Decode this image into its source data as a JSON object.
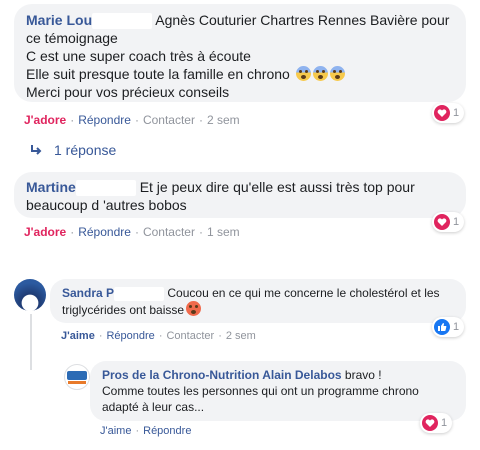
{
  "comments": [
    {
      "author": "Marie Lou",
      "lines": [
        "Agnès Couturier Chartres Rennes Bavière pour",
        "ce témoignage",
        "C est une super coach très à écoute",
        "Elle suit presque toute la famille en chrono",
        "Merci pour vos précieux conseils"
      ],
      "actions": {
        "reaction": "J'adore",
        "reply": "Répondre",
        "contact": "Contacter",
        "time": "2 sem"
      },
      "reaction_count": "1"
    },
    {
      "author": "Martine",
      "lines": [
        "Et je peux dire qu'elle est aussi très top pour",
        "beaucoup d 'autres bobos"
      ],
      "actions": {
        "reaction": "J'adore",
        "reply": "Répondre",
        "contact": "Contacter",
        "time": "1 sem"
      },
      "reaction_count": "1"
    },
    {
      "author": "Sandra P",
      "lines": [
        "Coucou en ce qui me concerne le cholestérol et les",
        "triglycérides ont baisse"
      ],
      "actions": {
        "reaction": "J'aime",
        "reply": "Répondre",
        "contact": "Contacter",
        "time": "2 sem"
      },
      "reaction_count": "1"
    },
    {
      "author": "Pros de la Chrono-Nutrition Alain Delabos",
      "lines": [
        "bravo !",
        "Comme toutes les personnes qui ont un programme chrono",
        "adapté à leur cas..."
      ],
      "actions": {
        "reaction": "J'aime",
        "reply": "Répondre"
      },
      "reaction_count": "1"
    }
  ],
  "replies_link": "1 réponse",
  "icons": {
    "love": "heart-icon",
    "like": "thumbs-up-icon",
    "reply_arrow": "reply-arrow-icon",
    "emoji_scream": "face-screaming-emoji",
    "emoji_heart_eyes": "heart-eyes-emoji"
  },
  "colors": {
    "link": "#385898",
    "love": "#e0245e",
    "like": "#1877f2",
    "bubble": "#f2f3f5",
    "meta": "#90949c"
  }
}
